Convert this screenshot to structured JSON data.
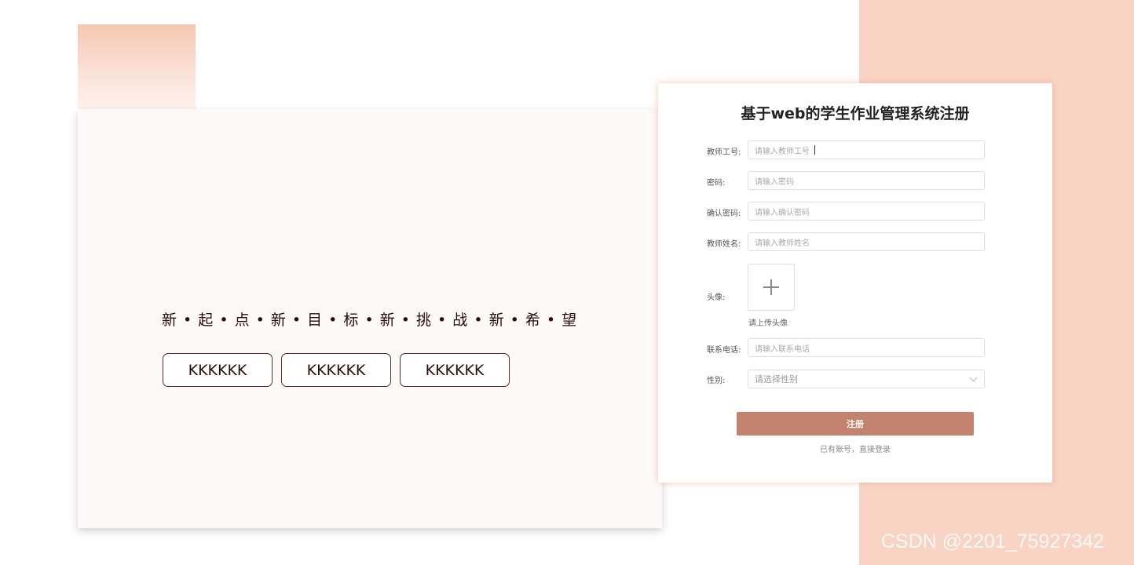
{
  "left": {
    "slogan": "新 • 起 • 点 • 新 • 目 • 标 • 新 • 挑 • 战 • 新 • 希 • 望",
    "buttons": [
      "KKKKKK",
      "KKKKKK",
      "KKKKKK"
    ]
  },
  "form": {
    "title": "基于web的学生作业管理系统注册",
    "fields": {
      "teacher_id": {
        "label": "教师工号:",
        "placeholder": "请输入教师工号"
      },
      "password": {
        "label": "密码:",
        "placeholder": "请输入密码"
      },
      "confirm_password": {
        "label": "确认密码:",
        "placeholder": "请输入确认密码"
      },
      "teacher_name": {
        "label": "教师姓名:",
        "placeholder": "请输入教师姓名"
      },
      "avatar": {
        "label": "头像:",
        "hint": "请上传头像"
      },
      "phone": {
        "label": "联系电话:",
        "placeholder": "请输入联系电话"
      },
      "gender": {
        "label": "性别:",
        "placeholder": "请选择性别"
      }
    },
    "submit_label": "注册",
    "login_link": "已有账号，直接登录"
  },
  "watermark": "CSDN @2201_75927342",
  "colors": {
    "accent": "#c3836e",
    "peach_bg": "#f9d4c4",
    "panel_bg": "#fdf9f9"
  }
}
